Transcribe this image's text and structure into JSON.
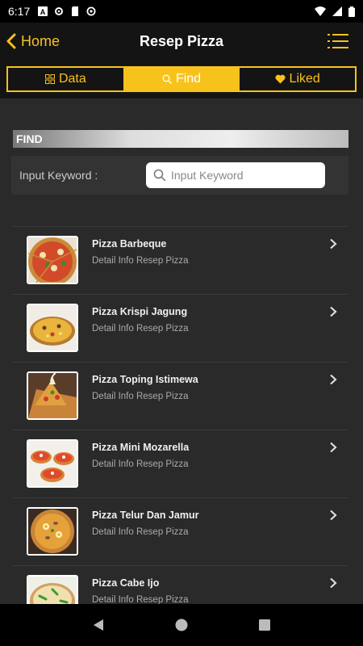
{
  "status": {
    "time": "6:17"
  },
  "appbar": {
    "back_label": "Home",
    "title": "Resep Pizza"
  },
  "tabs": [
    {
      "label": "Data"
    },
    {
      "label": "Find"
    },
    {
      "label": "Liked"
    }
  ],
  "find": {
    "header": "FIND",
    "label": "Input Keyword :",
    "placeholder": "Input Keyword"
  },
  "recipes": [
    {
      "title": "Pizza Barbeque",
      "subtitle": "Detail Info Resep Pizza"
    },
    {
      "title": "Pizza Krispi Jagung",
      "subtitle": "Detail Info Resep Pizza"
    },
    {
      "title": "Pizza Toping Istimewa",
      "subtitle": "Detail Info Resep Pizza"
    },
    {
      "title": "Pizza Mini Mozarella",
      "subtitle": "Detail Info Resep Pizza"
    },
    {
      "title": "Pizza Telur Dan Jamur",
      "subtitle": "Detail Info Resep Pizza"
    },
    {
      "title": "Pizza Cabe Ijo",
      "subtitle": "Detail Info Resep Pizza"
    }
  ],
  "colors": {
    "accent": "#f8c21c",
    "background": "#2a2a2a",
    "bar": "#141414"
  }
}
